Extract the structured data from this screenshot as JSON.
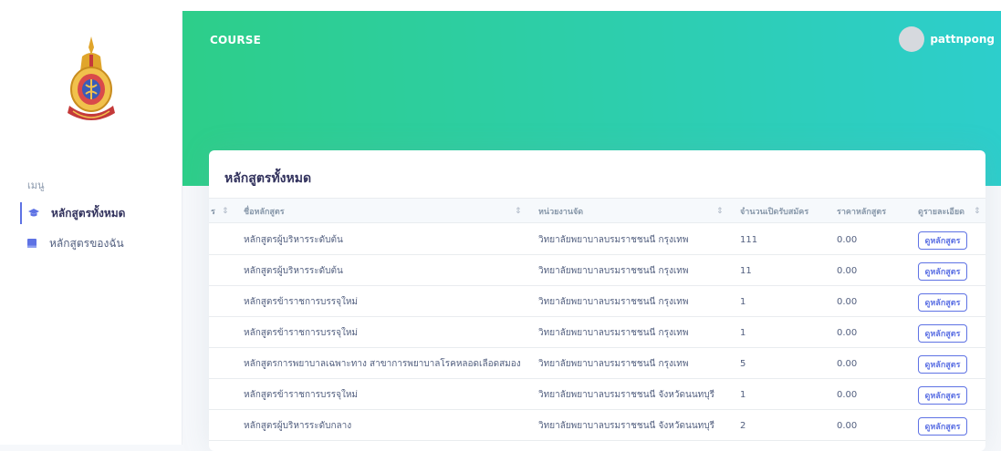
{
  "app": {
    "brand": "COURSE"
  },
  "user": {
    "name": "pattnpong"
  },
  "sidebar": {
    "menu_heading": "เมนู",
    "items": [
      {
        "label": "หลักสูตรทั้งหมด",
        "icon": "graduation-cap-icon",
        "active": true
      },
      {
        "label": "หลักสูตรของฉัน",
        "icon": "book-icon",
        "active": false
      }
    ]
  },
  "main": {
    "card_title": "หลักสูตรทั้งหมด",
    "table": {
      "columns": [
        "ชื่อหลักสูตร",
        "หน่วยงานจัด",
        "จำนวนเปิดรับสมัคร",
        "ราคาหลักสูตร",
        "ดูรายละเอียด"
      ],
      "partial_column_label": "ร",
      "view_button_label": "ดูหลักสูตร",
      "rows": [
        {
          "name": "หลักสูตรผู้บริหารระดับต้น",
          "org": "วิทยาลัยพยาบาลบรมราชชนนี กรุงเทพ",
          "seats": "111",
          "price": "0.00"
        },
        {
          "name": "หลักสูตรผู้บริหารระดับต้น",
          "org": "วิทยาลัยพยาบาลบรมราชชนนี กรุงเทพ",
          "seats": "11",
          "price": "0.00"
        },
        {
          "name": "หลักสูตรข้าราชการบรรจุใหม่",
          "org": "วิทยาลัยพยาบาลบรมราชชนนี กรุงเทพ",
          "seats": "1",
          "price": "0.00"
        },
        {
          "name": "หลักสูตรข้าราชการบรรจุใหม่",
          "org": "วิทยาลัยพยาบาลบรมราชชนนี กรุงเทพ",
          "seats": "1",
          "price": "0.00"
        },
        {
          "name": "หลักสูตรการพยาบาลเฉพาะทาง สาขาการพยาบาลโรคหลอดเลือดสมอง",
          "org": "วิทยาลัยพยาบาลบรมราชชนนี กรุงเทพ",
          "seats": "5",
          "price": "0.00"
        },
        {
          "name": "หลักสูตรข้าราชการบรรจุใหม่",
          "org": "วิทยาลัยพยาบาลบรมราชชนนี จังหวัดนนทบุรี",
          "seats": "1",
          "price": "0.00"
        },
        {
          "name": "หลักสูตรผู้บริหารระดับกลาง",
          "org": "วิทยาลัยพยาบาลบรมราชชนนี จังหวัดนนทบุรี",
          "seats": "2",
          "price": "0.00"
        }
      ]
    }
  },
  "colors": {
    "accent": "#5e72e4",
    "header_from": "#2dce89",
    "header_to": "#2dcecc"
  }
}
